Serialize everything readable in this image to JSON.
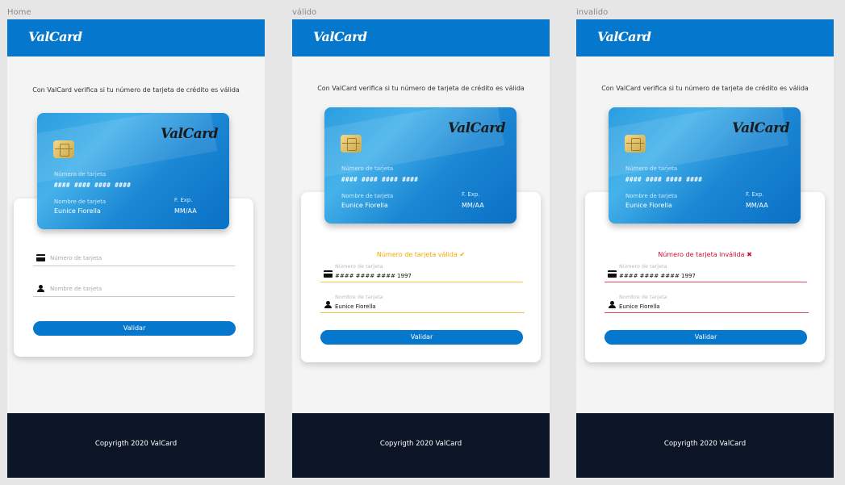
{
  "labels": [
    "Home",
    "válido",
    "invalido"
  ],
  "app": {
    "logo": "ValCard",
    "intro": "Con ValCard verifica si tu número de tarjeta de crédito es válida",
    "footer": "Copyrigth 2020 ValCard",
    "button": "Validar"
  },
  "card": {
    "logo": "ValCard",
    "number_label": "Número de tarjeta",
    "number_mask": "#### #### #### ####",
    "name_label": "Nombre de tarjeta",
    "name": "Eunice Fiorella",
    "exp_label": "F. Exp.",
    "exp": "MM/AA"
  },
  "form": {
    "number_placeholder": "Número de tarjeta",
    "name_placeholder": "Nombre de tarjeta",
    "number_label": "Número de tarjeta",
    "name_label": "Nombre de tarjeta",
    "number_value": "#### #### #### 1997",
    "name_value": "Eunice Fiorella"
  },
  "messages": {
    "valid": "Número de tarjeta válida",
    "valid_mark": "✔",
    "invalid": "Número de tarjeta inválida",
    "invalid_mark": "✖"
  },
  "colors": {
    "primary": "#0577cc",
    "footer": "#0c1526",
    "valid": "#f0a800",
    "invalid": "#c8102e"
  },
  "icons": [
    "credit-card-icon",
    "user-icon",
    "chip-icon",
    "check-icon",
    "cross-icon"
  ]
}
